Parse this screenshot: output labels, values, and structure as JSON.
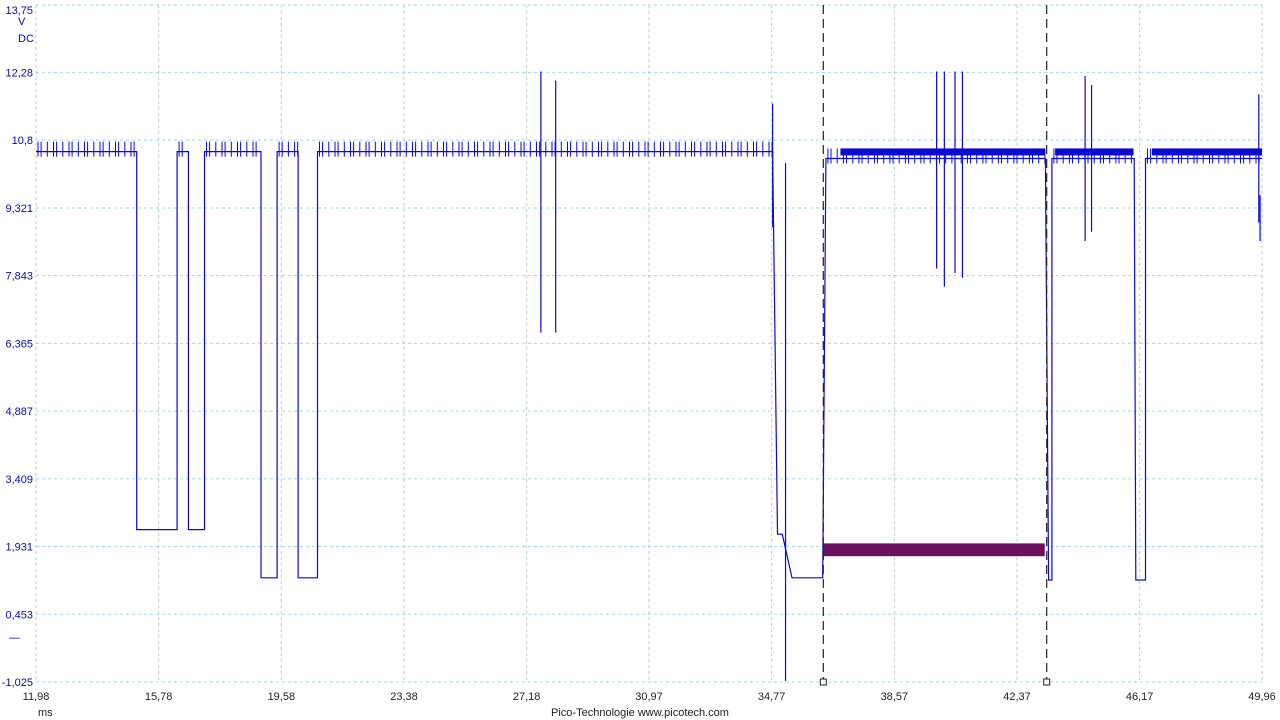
{
  "colors": {
    "background": "#ffffff",
    "grid": "#a9d6d6",
    "trace": "#0a0ad2",
    "axis_text": "#0a0aa0",
    "cursor": "#222222",
    "measure_bar": "#6b0f5e"
  },
  "labels": {
    "y_unit": "V",
    "y_coupling": "DC",
    "x_unit": "ms",
    "footer": "Pico-Technologie  www.picotech.com",
    "channel_marker": "—"
  },
  "chart_data": {
    "type": "line",
    "title": "",
    "xlabel": "ms",
    "ylabel": "V",
    "xlim": [
      11.98,
      49.96
    ],
    "ylim": [
      -1.025,
      13.75
    ],
    "grid": true,
    "x_ticks": [
      "11,98",
      "15,78",
      "19,58",
      "23,38",
      "27,18",
      "30,97",
      "34,77",
      "38,57",
      "42,37",
      "46,17",
      "49,96"
    ],
    "y_ticks": [
      "13,75",
      "12,28",
      "10,8",
      "9,321",
      "7,843",
      "6,365",
      "4,887",
      "3,409",
      "1,931",
      "0,453",
      "-1,025"
    ],
    "x_tick_values": [
      11.98,
      15.78,
      19.58,
      23.38,
      27.18,
      30.97,
      34.77,
      38.57,
      42.37,
      46.17,
      49.96
    ],
    "y_tick_values": [
      13.75,
      12.28,
      10.8,
      9.321,
      7.843,
      6.365,
      4.887,
      3.409,
      1.931,
      0.453,
      -1.025
    ],
    "series": [
      {
        "points": [
          [
            11.98,
            10.55
          ],
          [
            15.1,
            10.55
          ],
          [
            15.1,
            2.3
          ],
          [
            16.35,
            2.3
          ],
          [
            16.35,
            10.55
          ],
          [
            16.7,
            10.55
          ],
          [
            16.7,
            2.3
          ],
          [
            17.2,
            2.3
          ],
          [
            17.2,
            10.55
          ],
          [
            18.95,
            10.55
          ],
          [
            18.95,
            1.25
          ],
          [
            19.45,
            1.25
          ],
          [
            19.45,
            10.55
          ],
          [
            20.1,
            10.55
          ],
          [
            20.1,
            1.25
          ],
          [
            20.7,
            1.25
          ],
          [
            20.7,
            10.55
          ],
          [
            34.8,
            10.55
          ],
          [
            34.95,
            2.2
          ],
          [
            35.1,
            2.2
          ],
          [
            35.4,
            1.25
          ],
          [
            36.35,
            1.25
          ],
          [
            36.45,
            10.4
          ],
          [
            43.25,
            10.4
          ],
          [
            43.35,
            1.2
          ],
          [
            43.45,
            1.2
          ],
          [
            43.45,
            10.4
          ],
          [
            46.0,
            10.4
          ],
          [
            46.05,
            1.2
          ],
          [
            46.35,
            1.2
          ],
          [
            46.35,
            10.4
          ],
          [
            49.96,
            10.4
          ]
        ],
        "spikes": [
          [
            27.62,
            12.3,
            6.6
          ],
          [
            28.08,
            12.1,
            6.6
          ],
          [
            34.8,
            11.6,
            8.9
          ],
          [
            35.2,
            10.3,
            -1.0
          ],
          [
            39.88,
            12.3,
            8.0
          ],
          [
            40.12,
            12.3,
            7.6
          ],
          [
            40.45,
            12.3,
            7.9
          ],
          [
            40.68,
            12.3,
            7.8
          ],
          [
            44.48,
            12.2,
            8.6
          ],
          [
            44.68,
            12.0,
            8.8
          ],
          [
            49.86,
            11.8,
            9.0
          ],
          [
            49.9,
            9.6,
            8.6
          ]
        ]
      }
    ],
    "cursors_x": [
      36.37,
      43.29
    ],
    "measurement_band": {
      "x_start": 36.37,
      "x_end": 43.23,
      "y_low": 1.72,
      "y_high": 2.0
    }
  }
}
